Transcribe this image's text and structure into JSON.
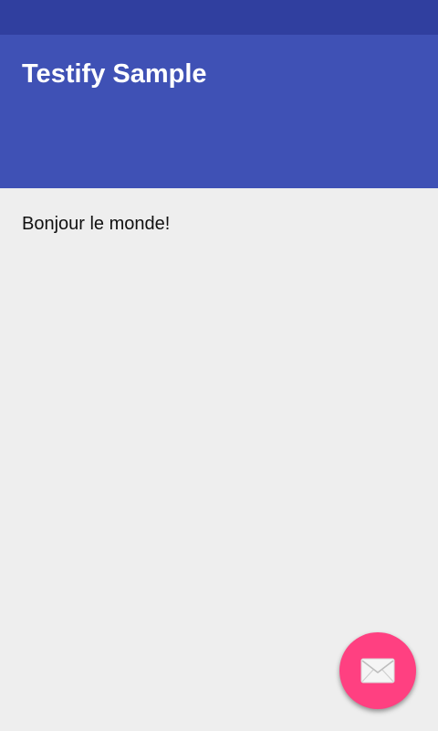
{
  "app_bar": {
    "title": "Testify Sample"
  },
  "content": {
    "greeting": "Bonjour le monde!"
  },
  "fab": {
    "icon": "mail-icon"
  },
  "colors": {
    "status_bar": "#303F9F",
    "primary": "#3F51B5",
    "accent": "#FF4081",
    "background": "#EEEEEE"
  }
}
